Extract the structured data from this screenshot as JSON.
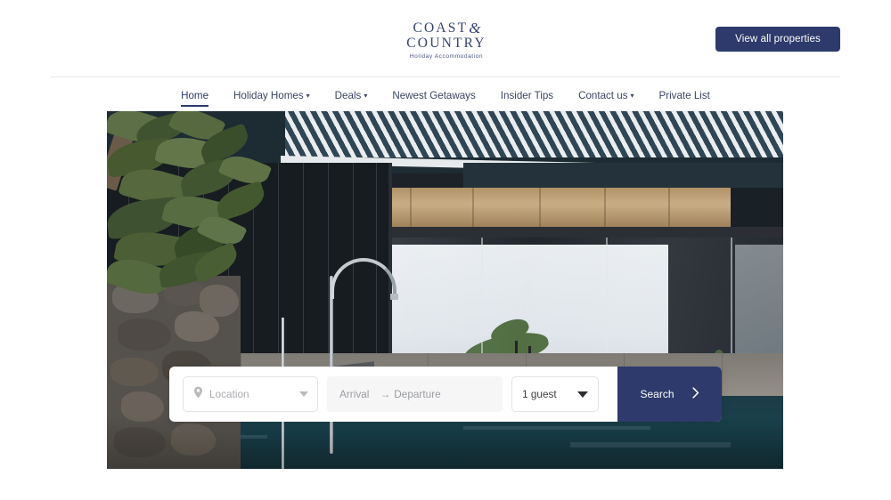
{
  "brand": {
    "logo_line1": "COAST",
    "logo_amp": "&",
    "logo_line2": "COUNTRY",
    "tagline": "Holiday Accommodation",
    "navy": "#2d3a6b"
  },
  "header": {
    "cta_label": "View all properties"
  },
  "nav": {
    "items": [
      {
        "label": "Home",
        "caret": "",
        "active": true
      },
      {
        "label": "Holiday Homes",
        "caret": "▾",
        "active": false
      },
      {
        "label": "Deals",
        "caret": "▾",
        "active": false
      },
      {
        "label": "Newest Getaways",
        "caret": "",
        "active": false
      },
      {
        "label": "Insider Tips",
        "caret": "",
        "active": false
      },
      {
        "label": "Contact us",
        "caret": "▾",
        "active": false
      },
      {
        "label": "Private List",
        "caret": "",
        "active": false
      }
    ]
  },
  "search": {
    "location_placeholder": "Location",
    "location_icon": "map-pin-icon",
    "arrival_label": "Arrival",
    "arrow": "→",
    "departure_label": "Departure",
    "guests_value": "1 guest",
    "search_label": "Search",
    "search_chevron": "›"
  }
}
